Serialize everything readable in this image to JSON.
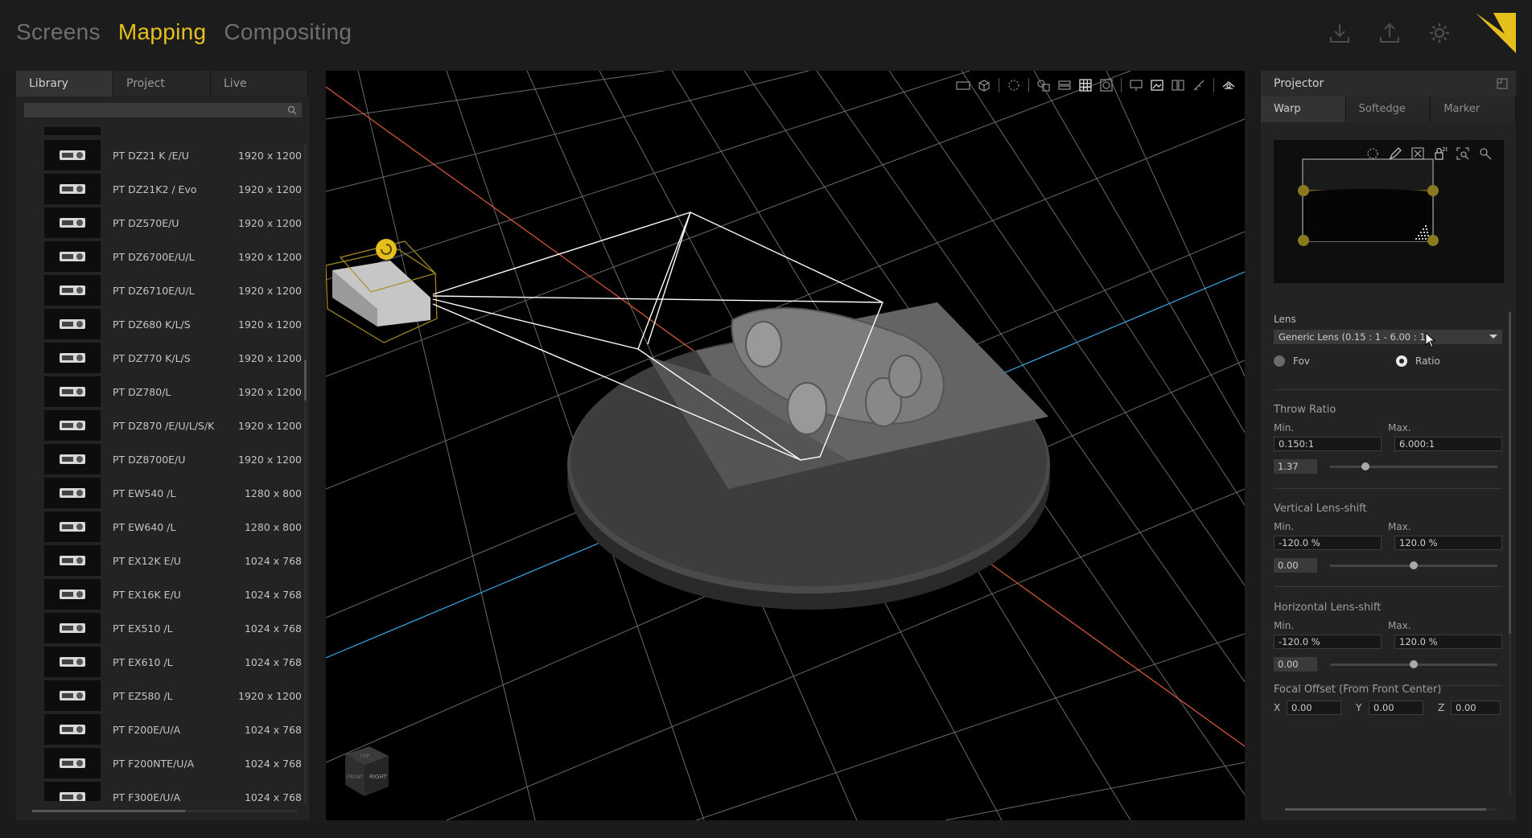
{
  "modes": [
    {
      "label": "Screens",
      "active": false
    },
    {
      "label": "Mapping",
      "active": true
    },
    {
      "label": "Compositing",
      "active": false
    }
  ],
  "top_icons": [
    "download-icon",
    "upload-icon",
    "settings-gear-icon"
  ],
  "accent_color": "#e5c01d",
  "left_panel": {
    "tabs": [
      {
        "label": "Library",
        "active": true
      },
      {
        "label": "Project",
        "active": false
      },
      {
        "label": "Live",
        "active": false
      }
    ],
    "search_placeholder": "",
    "items": [
      {
        "name": "PT DZ21 K /E/U",
        "res": "1920 x 1200"
      },
      {
        "name": "PT DZ21K2 / Evo",
        "res": "1920 x 1200"
      },
      {
        "name": "PT DZ570E/U",
        "res": "1920 x 1200"
      },
      {
        "name": "PT DZ6700E/U/L",
        "res": "1920 x 1200"
      },
      {
        "name": "PT DZ6710E/U/L",
        "res": "1920 x 1200"
      },
      {
        "name": "PT DZ680 K/L/S",
        "res": "1920 x 1200"
      },
      {
        "name": "PT DZ770 K/L/S",
        "res": "1920 x 1200"
      },
      {
        "name": "PT DZ780/L",
        "res": "1920 x 1200"
      },
      {
        "name": "PT DZ870 /E/U/L/S/K",
        "res": "1920 x 1200"
      },
      {
        "name": "PT DZ8700E/U",
        "res": "1920 x 1200"
      },
      {
        "name": "PT EW540 /L",
        "res": "1280 x 800"
      },
      {
        "name": "PT EW640 /L",
        "res": "1280 x 800"
      },
      {
        "name": "PT EX12K E/U",
        "res": "1024 x 768"
      },
      {
        "name": "PT EX16K E/U",
        "res": "1024 x 768"
      },
      {
        "name": "PT EX510 /L",
        "res": "1024 x 768"
      },
      {
        "name": "PT EX610 /L",
        "res": "1024 x 768"
      },
      {
        "name": "PT EZ580 /L",
        "res": "1920 x 1200"
      },
      {
        "name": "PT F200E/U/A",
        "res": "1024 x 768"
      },
      {
        "name": "PT F200NTE/U/A",
        "res": "1024 x 768"
      },
      {
        "name": "PT F300E/U/A",
        "res": "1024 x 768"
      }
    ]
  },
  "viewport": {
    "nav_cube_labels": [
      "TOP",
      "FRONT",
      "RIGHT"
    ]
  },
  "right_panel": {
    "title": "Projector",
    "tabs": [
      {
        "label": "Warp",
        "active": true
      },
      {
        "label": "Softedge",
        "active": false
      },
      {
        "label": "Marker",
        "active": false
      }
    ],
    "warp_grid_count": "20",
    "lens": {
      "label": "Lens",
      "selected": "Generic Lens (0.15 : 1 - 6.00 : 1)",
      "radio_fov": "Fov",
      "radio_ratio": "Ratio",
      "selected_mode": "Ratio"
    },
    "throw_ratio": {
      "title": "Throw Ratio",
      "min_label": "Min.",
      "max_label": "Max.",
      "min": "0.150:1",
      "max": "6.000:1",
      "value": "1.37",
      "slider_fraction": 0.21
    },
    "vertical_shift": {
      "title": "Vertical Lens-shift",
      "min_label": "Min.",
      "max_label": "Max.",
      "min": "-120.0 %",
      "max": "120.0 %",
      "value": "0.00",
      "slider_fraction": 0.5
    },
    "horizontal_shift": {
      "title": "Horizontal Lens-shift",
      "min_label": "Min.",
      "max_label": "Max.",
      "min": "-120.0 %",
      "max": "120.0 %",
      "value": "0.00",
      "slider_fraction": 0.5
    },
    "focal_offset": {
      "title": "Focal Offset (From Front Center)",
      "x_label": "X",
      "x": "0.00",
      "y_label": "Y",
      "y": "0.00",
      "z_label": "Z",
      "z": "0.00"
    }
  }
}
